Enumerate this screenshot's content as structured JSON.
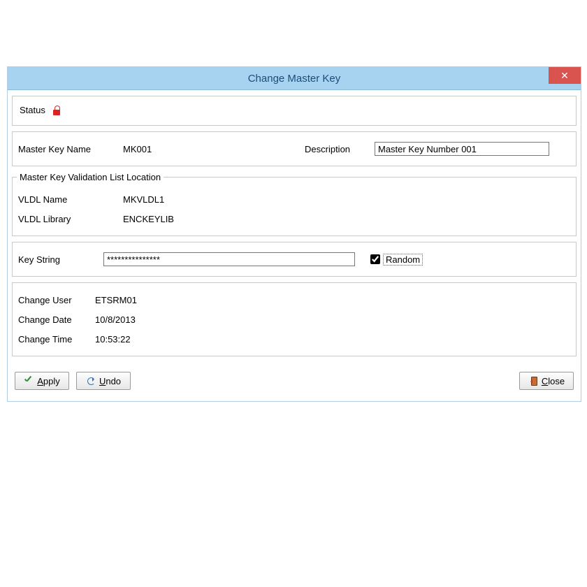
{
  "window": {
    "title": "Change Master Key"
  },
  "status": {
    "label": "Status"
  },
  "masterkey": {
    "name_label": "Master Key Name",
    "name_value": "MK001",
    "description_label": "Description",
    "description_value": "Master Key Number 001"
  },
  "vldl": {
    "legend": "Master Key Validation List Location",
    "name_label": "VLDL Name",
    "name_value": "MKVLDL1",
    "library_label": "VLDL Library",
    "library_value": "ENCKEYLIB"
  },
  "keystring": {
    "label": "Key String",
    "value": "***************",
    "random_label": "Random",
    "random_checked": true
  },
  "changeinfo": {
    "user_label": "Change User",
    "user_value": "ETSRM01",
    "date_label": "Change Date",
    "date_value": "10/8/2013",
    "time_label": "Change Time",
    "time_value": "10:53:22"
  },
  "buttons": {
    "apply_pref": "A",
    "apply_rest": "pply",
    "undo_pref": "U",
    "undo_rest": "ndo",
    "close_pref": "C",
    "close_rest": "lose"
  }
}
